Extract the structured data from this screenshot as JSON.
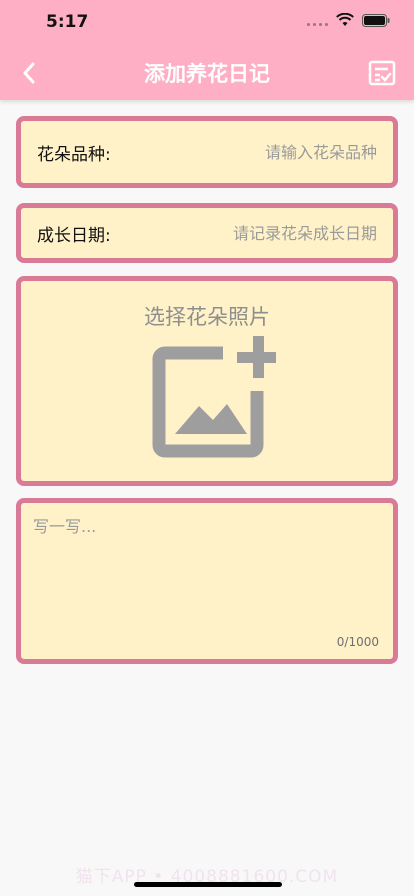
{
  "status_bar": {
    "time": "5:17"
  },
  "nav": {
    "title": "添加养花日记",
    "back_icon": "chevron-left-icon",
    "action_icon": "checklist-icon"
  },
  "form": {
    "variety": {
      "label": "花朵品种:",
      "placeholder": "请输入花朵品种"
    },
    "date": {
      "label": "成长日期:",
      "placeholder": "请记录花朵成长日期"
    },
    "photo": {
      "title": "选择花朵照片",
      "icon": "add-photo-icon"
    },
    "notes": {
      "placeholder": "写一写...",
      "counter": "0/1000"
    }
  },
  "watermark": "猫下APP • 4008881600.COM",
  "colors": {
    "header": "#ffafc5",
    "card_bg": "#fff2c9",
    "card_border": "#d97a96",
    "icon_gray": "#9e9e9e"
  }
}
